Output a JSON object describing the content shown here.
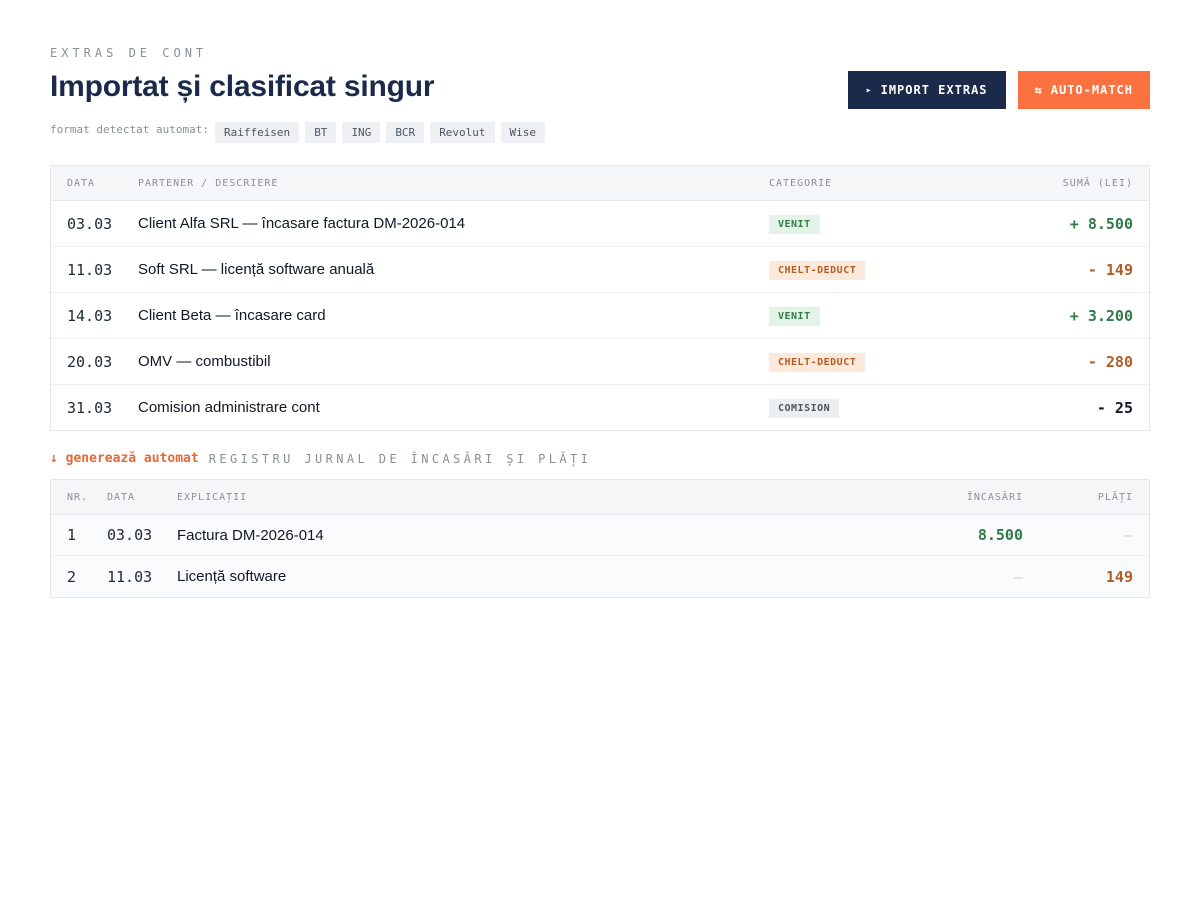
{
  "header": {
    "eyebrow": "EXTRAS DE CONT",
    "title": "Importat și clasificat singur",
    "formats_label": "format detectat automat:",
    "formats": [
      "Raiffeisen",
      "BT",
      "ING",
      "BCR",
      "Revolut",
      "Wise"
    ]
  },
  "actions": {
    "import_icon": "▸",
    "import_label": "IMPORT EXTRAS",
    "match_icon": "⇆",
    "match_label": "AUTO-MATCH"
  },
  "statement": {
    "columns": {
      "date": "DATA",
      "desc": "PARTENER / DESCRIERE",
      "cat": "CATEGORIE",
      "sum": "SUMĂ (LEI)"
    },
    "rows": [
      {
        "date": "03.03",
        "desc": "Client Alfa SRL — încasare factura DM-2026-014",
        "cat": "VENIT",
        "sum": "+ 8.500"
      },
      {
        "date": "11.03",
        "desc": "Soft SRL — licență software anuală",
        "cat": "CHELT-DEDUCT",
        "sum": "- 149"
      },
      {
        "date": "14.03",
        "desc": "Client Beta — încasare card",
        "cat": "VENIT",
        "sum": "+ 3.200"
      },
      {
        "date": "20.03",
        "desc": "OMV — combustibil",
        "cat": "CHELT-DEDUCT",
        "sum": "- 280"
      },
      {
        "date": "31.03",
        "desc": "Comision administrare cont",
        "cat": "COMISION",
        "sum": "- 25"
      }
    ]
  },
  "generate": {
    "link": "↓ generează automat",
    "title": "REGISTRU JURNAL DE ÎNCASĂRI ȘI PLĂȚI"
  },
  "journal": {
    "columns": {
      "nr": "NR.",
      "date": "DATA",
      "exp": "EXPLICAȚII",
      "inc": "ÎNCASĂRI",
      "pla": "PLĂȚI"
    },
    "rows": [
      {
        "nr": "1",
        "date": "03.03",
        "exp": "Factura DM-2026-014",
        "inc": "8.500",
        "pla": "—"
      },
      {
        "nr": "2",
        "date": "11.03",
        "exp": "Licență software",
        "inc": "—",
        "pla": "149"
      }
    ]
  },
  "colors": {
    "navy": "#1b2a4a",
    "orange": "#fb7140",
    "income": "#2f7b4a",
    "expense": "#b45d22",
    "neutral": "#111827"
  }
}
